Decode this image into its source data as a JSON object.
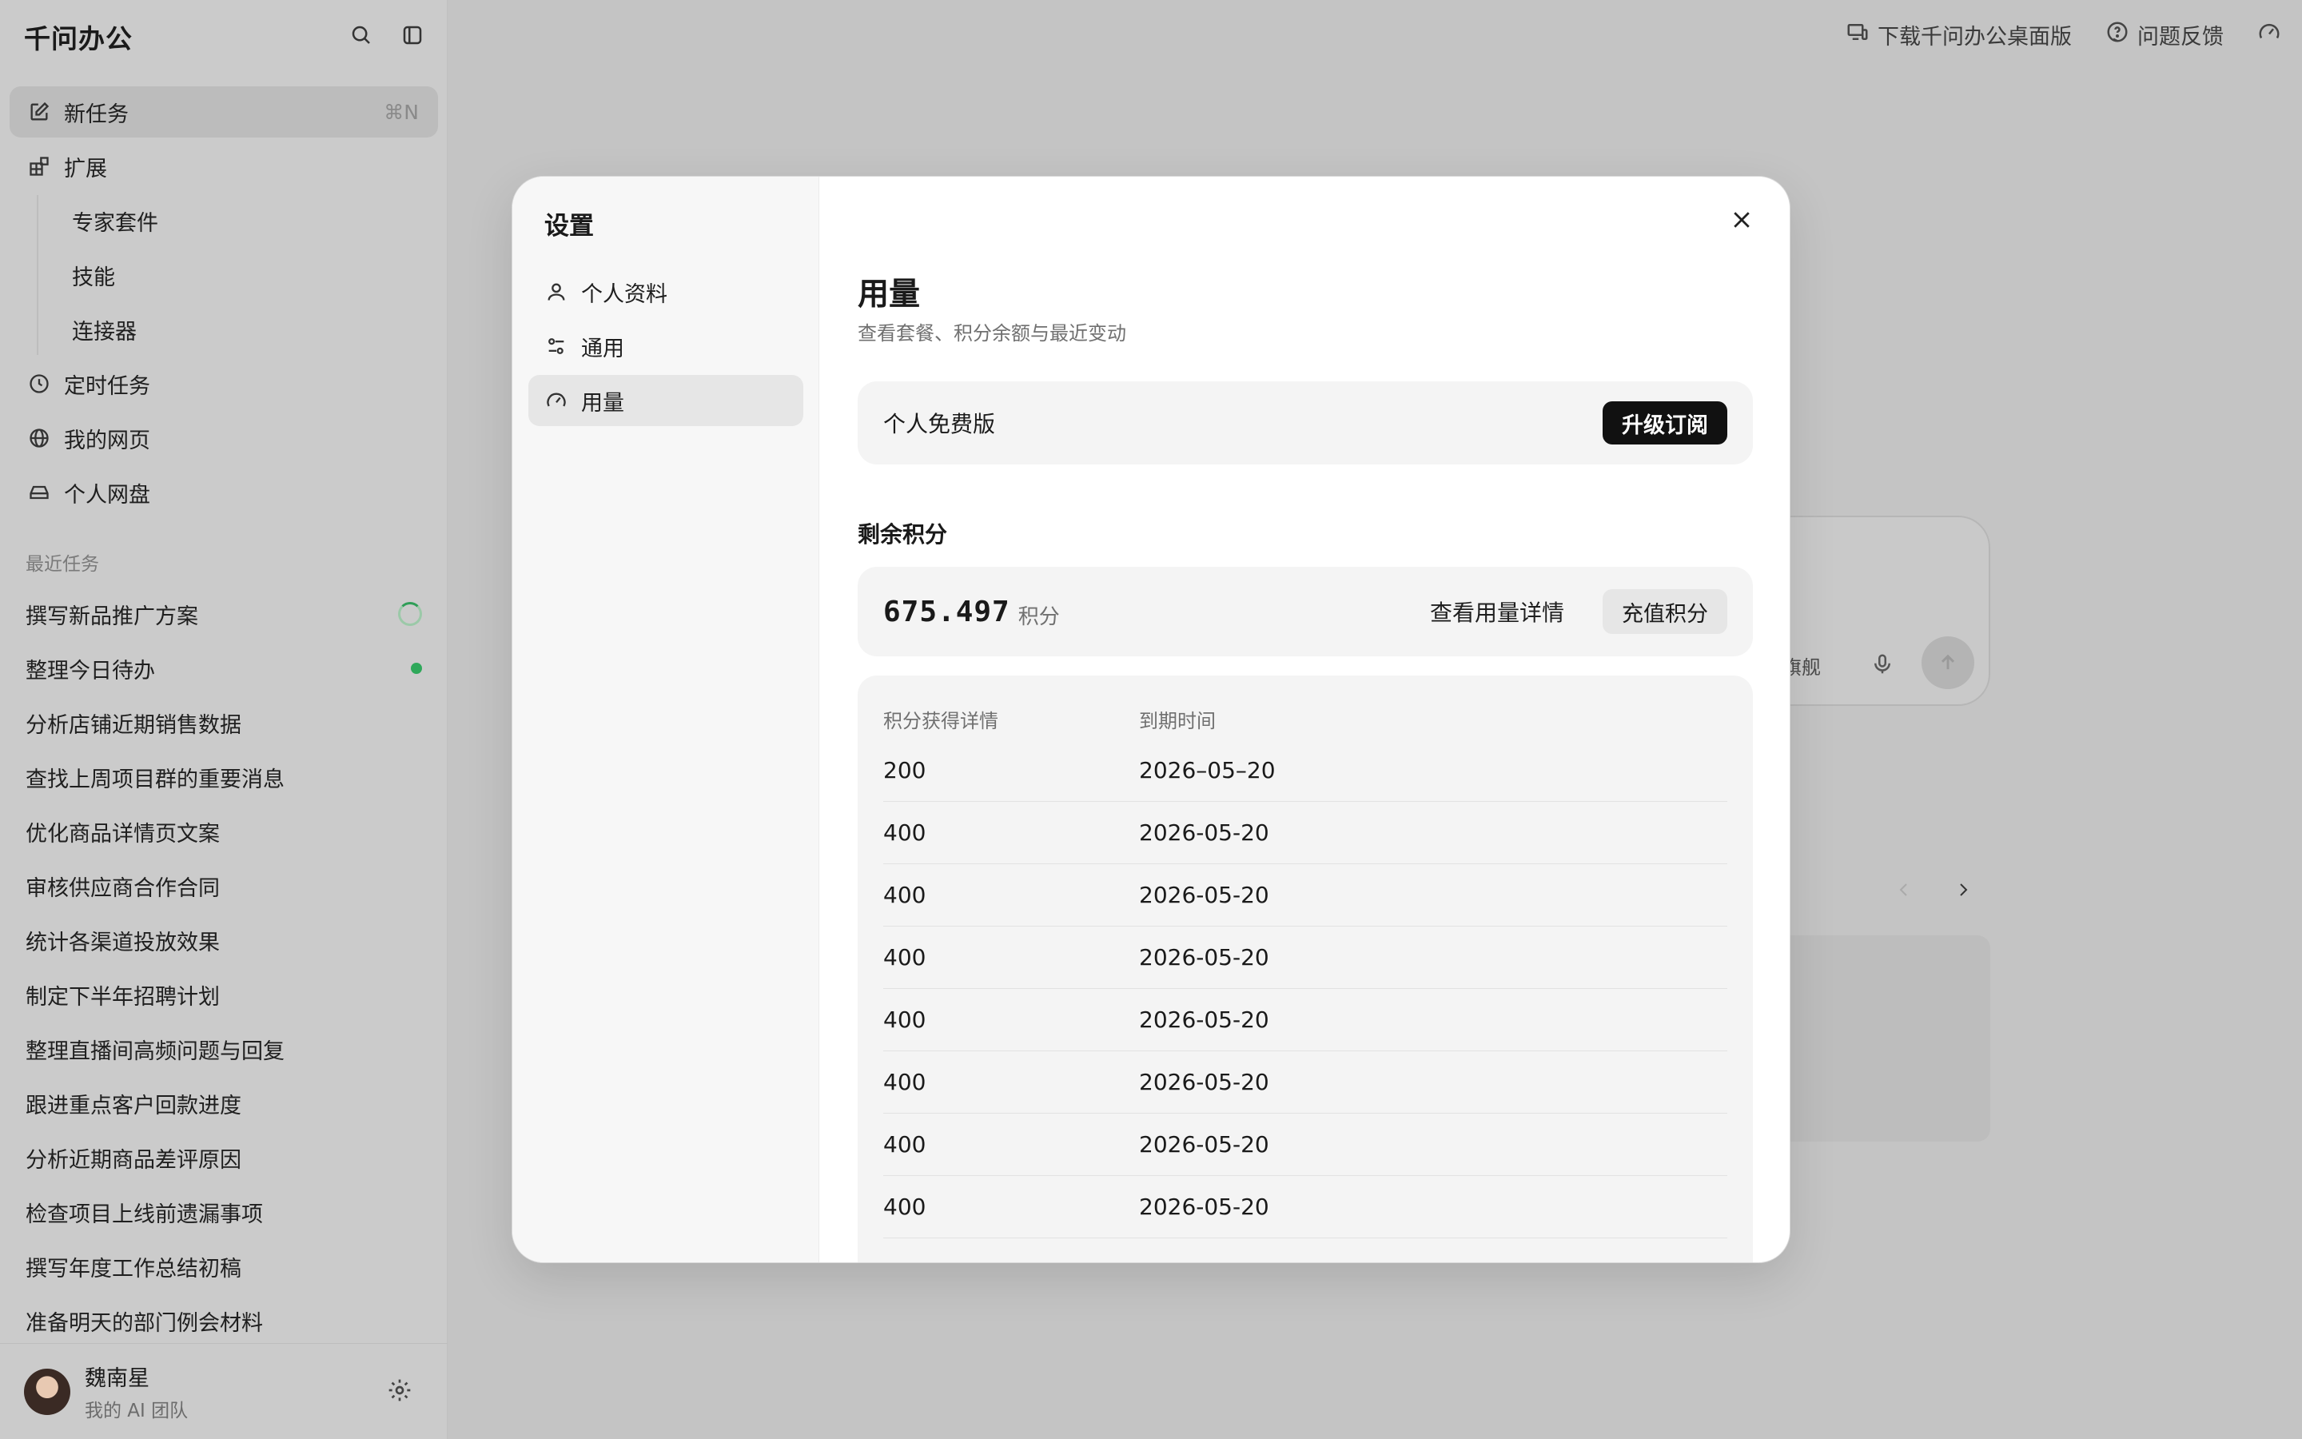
{
  "app": {
    "name": "千问办公",
    "topbar": {
      "download_label": "下载千问办公桌面版",
      "feedback_label": "问题反馈"
    }
  },
  "sidebar": {
    "nav": [
      {
        "label": "新任务",
        "shortcut": "⌘N",
        "icon": "edit-icon"
      },
      {
        "label": "扩展",
        "icon": "extension-icon"
      }
    ],
    "sub_items": [
      "专家套件",
      "技能",
      "连接器"
    ],
    "nav2": [
      {
        "label": "定时任务",
        "icon": "clock-icon"
      },
      {
        "label": "我的网页",
        "icon": "globe-icon"
      },
      {
        "label": "个人网盘",
        "icon": "drive-icon"
      }
    ],
    "recent_label": "最近任务",
    "recent": [
      {
        "label": "撰写新品推广方案",
        "status": "running"
      },
      {
        "label": "整理今日待办",
        "status": "done"
      },
      {
        "label": "分析店铺近期销售数据"
      },
      {
        "label": "查找上周项目群的重要消息"
      },
      {
        "label": "优化商品详情页文案"
      },
      {
        "label": "审核供应商合作合同"
      },
      {
        "label": "统计各渠道投放效果"
      },
      {
        "label": "制定下半年招聘计划"
      },
      {
        "label": "整理直播间高频问题与回复"
      },
      {
        "label": "跟进重点客户回款进度"
      },
      {
        "label": "分析近期商品差评原因"
      },
      {
        "label": "检查项目上线前遗漏事项"
      },
      {
        "label": "撰写年度工作总结初稿"
      },
      {
        "label": "准备明天的部门例会材料"
      }
    ],
    "user": {
      "name": "魏南星",
      "team": "我的 AI 团队"
    }
  },
  "background": {
    "partial_text": "旗舰"
  },
  "settings": {
    "title": "设置",
    "nav": [
      {
        "label": "个人资料",
        "icon": "user-icon"
      },
      {
        "label": "通用",
        "icon": "sliders-icon"
      },
      {
        "label": "用量",
        "icon": "gauge-icon",
        "active": true
      }
    ],
    "usage": {
      "heading": "用量",
      "subtitle": "查看套餐、积分余额与最近变动",
      "plan_name": "个人免费版",
      "upgrade_label": "升级订阅",
      "remaining_title": "剩余积分",
      "points": "675.497",
      "points_unit": "积分",
      "details_link": "查看用量详情",
      "recharge_label": "充值积分",
      "table": {
        "headers": [
          "积分获得详情",
          "到期时间"
        ],
        "rows": [
          [
            "200",
            "2026–05–20"
          ],
          [
            "400",
            "2026-05-20"
          ],
          [
            "400",
            "2026-05-20"
          ],
          [
            "400",
            "2026-05-20"
          ],
          [
            "400",
            "2026-05-20"
          ],
          [
            "400",
            "2026-05-20"
          ],
          [
            "400",
            "2026-05-20"
          ],
          [
            "400",
            "2026-05-20"
          ]
        ]
      }
    }
  }
}
